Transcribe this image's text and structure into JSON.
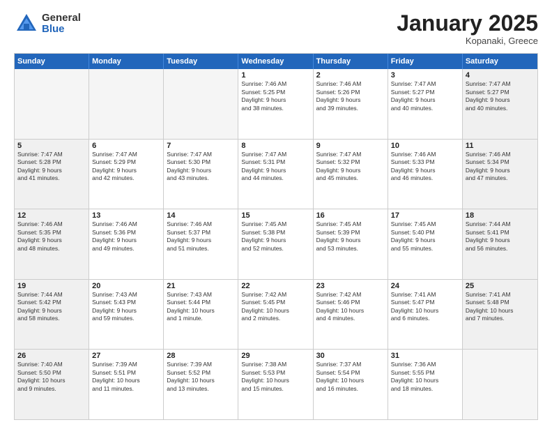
{
  "header": {
    "logo_general": "General",
    "logo_blue": "Blue",
    "month_title": "January 2025",
    "location": "Kopanaki, Greece"
  },
  "weekdays": [
    "Sunday",
    "Monday",
    "Tuesday",
    "Wednesday",
    "Thursday",
    "Friday",
    "Saturday"
  ],
  "rows": [
    [
      {
        "day": "",
        "text": "",
        "empty": true
      },
      {
        "day": "",
        "text": "",
        "empty": true
      },
      {
        "day": "",
        "text": "",
        "empty": true
      },
      {
        "day": "1",
        "text": "Sunrise: 7:46 AM\nSunset: 5:25 PM\nDaylight: 9 hours\nand 38 minutes."
      },
      {
        "day": "2",
        "text": "Sunrise: 7:46 AM\nSunset: 5:26 PM\nDaylight: 9 hours\nand 39 minutes."
      },
      {
        "day": "3",
        "text": "Sunrise: 7:47 AM\nSunset: 5:27 PM\nDaylight: 9 hours\nand 40 minutes."
      },
      {
        "day": "4",
        "text": "Sunrise: 7:47 AM\nSunset: 5:27 PM\nDaylight: 9 hours\nand 40 minutes.",
        "shaded": true
      }
    ],
    [
      {
        "day": "5",
        "text": "Sunrise: 7:47 AM\nSunset: 5:28 PM\nDaylight: 9 hours\nand 41 minutes.",
        "shaded": true
      },
      {
        "day": "6",
        "text": "Sunrise: 7:47 AM\nSunset: 5:29 PM\nDaylight: 9 hours\nand 42 minutes."
      },
      {
        "day": "7",
        "text": "Sunrise: 7:47 AM\nSunset: 5:30 PM\nDaylight: 9 hours\nand 43 minutes."
      },
      {
        "day": "8",
        "text": "Sunrise: 7:47 AM\nSunset: 5:31 PM\nDaylight: 9 hours\nand 44 minutes."
      },
      {
        "day": "9",
        "text": "Sunrise: 7:47 AM\nSunset: 5:32 PM\nDaylight: 9 hours\nand 45 minutes."
      },
      {
        "day": "10",
        "text": "Sunrise: 7:46 AM\nSunset: 5:33 PM\nDaylight: 9 hours\nand 46 minutes."
      },
      {
        "day": "11",
        "text": "Sunrise: 7:46 AM\nSunset: 5:34 PM\nDaylight: 9 hours\nand 47 minutes.",
        "shaded": true
      }
    ],
    [
      {
        "day": "12",
        "text": "Sunrise: 7:46 AM\nSunset: 5:35 PM\nDaylight: 9 hours\nand 48 minutes.",
        "shaded": true
      },
      {
        "day": "13",
        "text": "Sunrise: 7:46 AM\nSunset: 5:36 PM\nDaylight: 9 hours\nand 49 minutes."
      },
      {
        "day": "14",
        "text": "Sunrise: 7:46 AM\nSunset: 5:37 PM\nDaylight: 9 hours\nand 51 minutes."
      },
      {
        "day": "15",
        "text": "Sunrise: 7:45 AM\nSunset: 5:38 PM\nDaylight: 9 hours\nand 52 minutes."
      },
      {
        "day": "16",
        "text": "Sunrise: 7:45 AM\nSunset: 5:39 PM\nDaylight: 9 hours\nand 53 minutes."
      },
      {
        "day": "17",
        "text": "Sunrise: 7:45 AM\nSunset: 5:40 PM\nDaylight: 9 hours\nand 55 minutes."
      },
      {
        "day": "18",
        "text": "Sunrise: 7:44 AM\nSunset: 5:41 PM\nDaylight: 9 hours\nand 56 minutes.",
        "shaded": true
      }
    ],
    [
      {
        "day": "19",
        "text": "Sunrise: 7:44 AM\nSunset: 5:42 PM\nDaylight: 9 hours\nand 58 minutes.",
        "shaded": true
      },
      {
        "day": "20",
        "text": "Sunrise: 7:43 AM\nSunset: 5:43 PM\nDaylight: 9 hours\nand 59 minutes."
      },
      {
        "day": "21",
        "text": "Sunrise: 7:43 AM\nSunset: 5:44 PM\nDaylight: 10 hours\nand 1 minute."
      },
      {
        "day": "22",
        "text": "Sunrise: 7:42 AM\nSunset: 5:45 PM\nDaylight: 10 hours\nand 2 minutes."
      },
      {
        "day": "23",
        "text": "Sunrise: 7:42 AM\nSunset: 5:46 PM\nDaylight: 10 hours\nand 4 minutes."
      },
      {
        "day": "24",
        "text": "Sunrise: 7:41 AM\nSunset: 5:47 PM\nDaylight: 10 hours\nand 6 minutes."
      },
      {
        "day": "25",
        "text": "Sunrise: 7:41 AM\nSunset: 5:48 PM\nDaylight: 10 hours\nand 7 minutes.",
        "shaded": true
      }
    ],
    [
      {
        "day": "26",
        "text": "Sunrise: 7:40 AM\nSunset: 5:50 PM\nDaylight: 10 hours\nand 9 minutes.",
        "shaded": true
      },
      {
        "day": "27",
        "text": "Sunrise: 7:39 AM\nSunset: 5:51 PM\nDaylight: 10 hours\nand 11 minutes."
      },
      {
        "day": "28",
        "text": "Sunrise: 7:39 AM\nSunset: 5:52 PM\nDaylight: 10 hours\nand 13 minutes."
      },
      {
        "day": "29",
        "text": "Sunrise: 7:38 AM\nSunset: 5:53 PM\nDaylight: 10 hours\nand 15 minutes."
      },
      {
        "day": "30",
        "text": "Sunrise: 7:37 AM\nSunset: 5:54 PM\nDaylight: 10 hours\nand 16 minutes."
      },
      {
        "day": "31",
        "text": "Sunrise: 7:36 AM\nSunset: 5:55 PM\nDaylight: 10 hours\nand 18 minutes."
      },
      {
        "day": "",
        "text": "",
        "empty": true
      }
    ]
  ]
}
